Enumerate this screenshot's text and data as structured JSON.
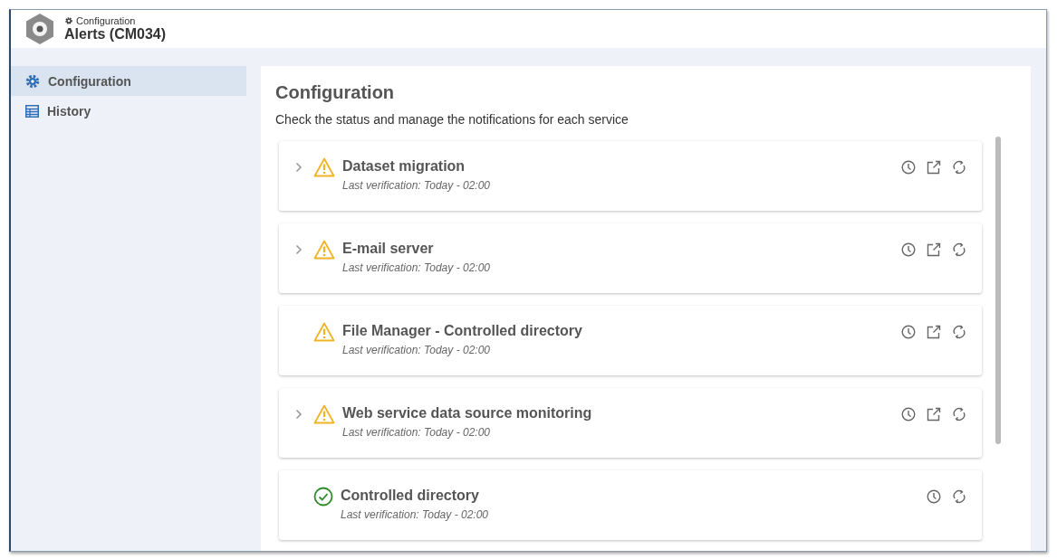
{
  "header": {
    "breadcrumb": "Configuration",
    "title": "Alerts (CM034)"
  },
  "sidebar": {
    "items": [
      {
        "label": "Configuration",
        "kind": "gear",
        "selected": true
      },
      {
        "label": "History",
        "kind": "table",
        "selected": false
      }
    ]
  },
  "panel": {
    "title": "Configuration",
    "description": "Check the status and manage the notifications for each service"
  },
  "services": [
    {
      "name": "Dataset migration",
      "verification": "Last verification: Today - 02:00",
      "kind": "warning",
      "expandable": true,
      "open_link": true
    },
    {
      "name": "E-mail server",
      "verification": "Last verification: Today - 02:00",
      "kind": "warning",
      "expandable": true,
      "open_link": true
    },
    {
      "name": "File Manager - Controlled directory",
      "verification": "Last verification: Today - 02:00",
      "kind": "warning",
      "expandable": false,
      "open_link": true
    },
    {
      "name": "Web service data source monitoring",
      "verification": "Last verification: Today - 02:00",
      "kind": "warning",
      "expandable": true,
      "open_link": true
    },
    {
      "name": "Controlled directory",
      "verification": "Last verification: Today - 02:00",
      "kind": "ok",
      "expandable": false,
      "open_link": false
    }
  ]
}
